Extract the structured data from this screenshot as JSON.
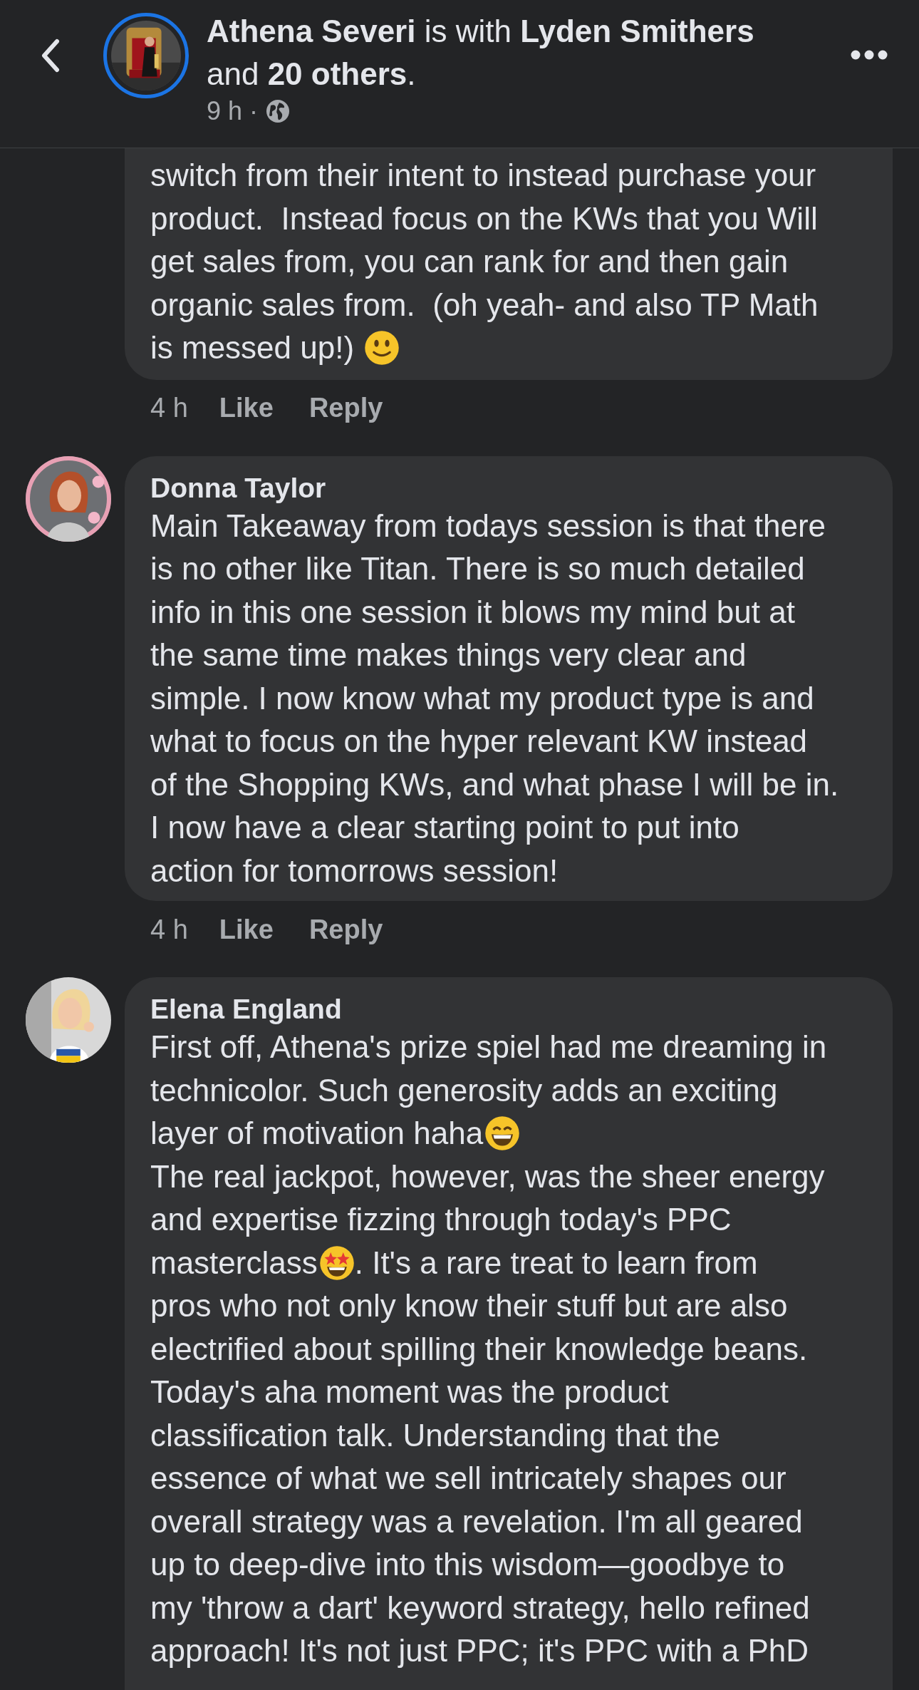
{
  "header": {
    "title": "**Athena Severi** is with **Lyden Smithers**\nand **20 others**.",
    "time": "9 h",
    "separator": "·"
  },
  "comments": [
    {
      "lines": [
        [
          {
            "kind": "text",
            "text": "switch from their intent to instead purchase your"
          }
        ],
        [
          {
            "kind": "text",
            "text": "product.  Instead focus on the KWs that you Will"
          }
        ],
        [
          {
            "kind": "text",
            "text": "get sales from, you can rank for and then gain"
          }
        ],
        [
          {
            "kind": "text",
            "text": "organic sales from.  (oh yeah- and also TP Math"
          }
        ],
        [
          {
            "kind": "text",
            "text": "is messed up!)"
          },
          {
            "kind": "slight-smile"
          }
        ]
      ],
      "time": "4 h",
      "like": "Like",
      "reply": "Reply"
    },
    {
      "author": "Donna Taylor",
      "avatar": {
        "kind": "picture"
      },
      "lines": [
        [
          {
            "kind": "text",
            "text": "Main Takeaway from todays session is that there"
          }
        ],
        [
          {
            "kind": "text",
            "text": "is no other like Titan. There is so much detailed"
          }
        ],
        [
          {
            "kind": "text",
            "text": "info in this one session it blows my mind but at"
          }
        ],
        [
          {
            "kind": "text",
            "text": "the same time makes things very clear and"
          }
        ],
        [
          {
            "kind": "text",
            "text": "simple. I now know what my product type is and"
          }
        ],
        [
          {
            "kind": "text",
            "text": "what to focus on the hyper relevant KW instead"
          }
        ],
        [
          {
            "kind": "text",
            "text": "of the Shopping KWs, and what phase I will be in."
          }
        ],
        [
          {
            "kind": "text",
            "text": "I now have a clear starting point to put into"
          }
        ],
        [
          {
            "kind": "text",
            "text": "action for tomorrows session!"
          }
        ]
      ],
      "time": "4 h",
      "like": "Like",
      "reply": "Reply"
    },
    {
      "author": "Elena England",
      "avatar": {
        "kind": "picture"
      },
      "lines": [
        [
          {
            "kind": "text",
            "text": "First off, Athena's prize spiel had me dreaming in"
          }
        ],
        [
          {
            "kind": "text",
            "text": "technicolor. Such generosity adds an exciting"
          }
        ],
        [
          {
            "kind": "text",
            "text": "layer of motivation haha"
          },
          {
            "kind": "grin"
          }
        ],
        [
          {
            "kind": "text",
            "text": "The real jackpot, however, was the sheer energy"
          }
        ],
        [
          {
            "kind": "text",
            "text": "and expertise fizzing through today's PPC"
          }
        ],
        [
          {
            "kind": "text",
            "text": "masterclass"
          },
          {
            "kind": "star-struck"
          },
          {
            "kind": "text",
            "text": ". It's a rare treat to learn from"
          }
        ],
        [
          {
            "kind": "text",
            "text": "pros who not only know their stuff but are also"
          }
        ],
        [
          {
            "kind": "text",
            "text": "electrified about spilling their knowledge beans."
          }
        ],
        [
          {
            "kind": "text",
            "text": "Today's aha moment was the product"
          }
        ],
        [
          {
            "kind": "text",
            "text": "classification talk. Understanding that the"
          }
        ],
        [
          {
            "kind": "text",
            "text": "essence of what we sell intricately shapes our"
          }
        ],
        [
          {
            "kind": "text",
            "text": "overall strategy was a revelation. I'm all geared"
          }
        ],
        [
          {
            "kind": "text",
            "text": "up to deep-dive into this wisdom—goodbye to"
          }
        ],
        [
          {
            "kind": "text",
            "text": "my 'throw a dart' keyword strategy, hello refined"
          }
        ],
        [
          {
            "kind": "text",
            "text": "approach! It's not just PPC; it's PPC with a PhD"
          }
        ]
      ]
    }
  ]
}
